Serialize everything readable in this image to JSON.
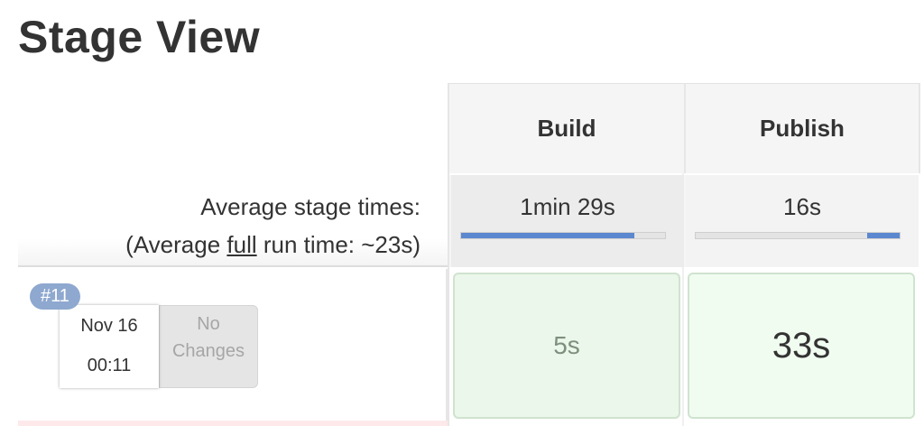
{
  "title": "Stage View",
  "stages": {
    "build": {
      "name": "Build",
      "avg_time": "1min 29s",
      "avg_fill": 0.85
    },
    "publish": {
      "name": "Publish",
      "avg_time": "16s",
      "avg_fill_start": 0.84,
      "avg_fill": 0.16
    }
  },
  "averages": {
    "stage_times_label": "Average stage times:",
    "full_prefix": "(Average ",
    "full_word": "full",
    "full_suffix": " run time: ~23s)"
  },
  "run": {
    "badge": "#11",
    "date": "Nov 16",
    "time": "00:11",
    "changes_line1": "No",
    "changes_line2": "Changes",
    "build_time": "5s",
    "publish_time": "33s"
  },
  "colors": {
    "bar_fill": "#5b87cf",
    "success_bg": "#eaf7ea",
    "badge_bg": "#8ea8cf"
  }
}
